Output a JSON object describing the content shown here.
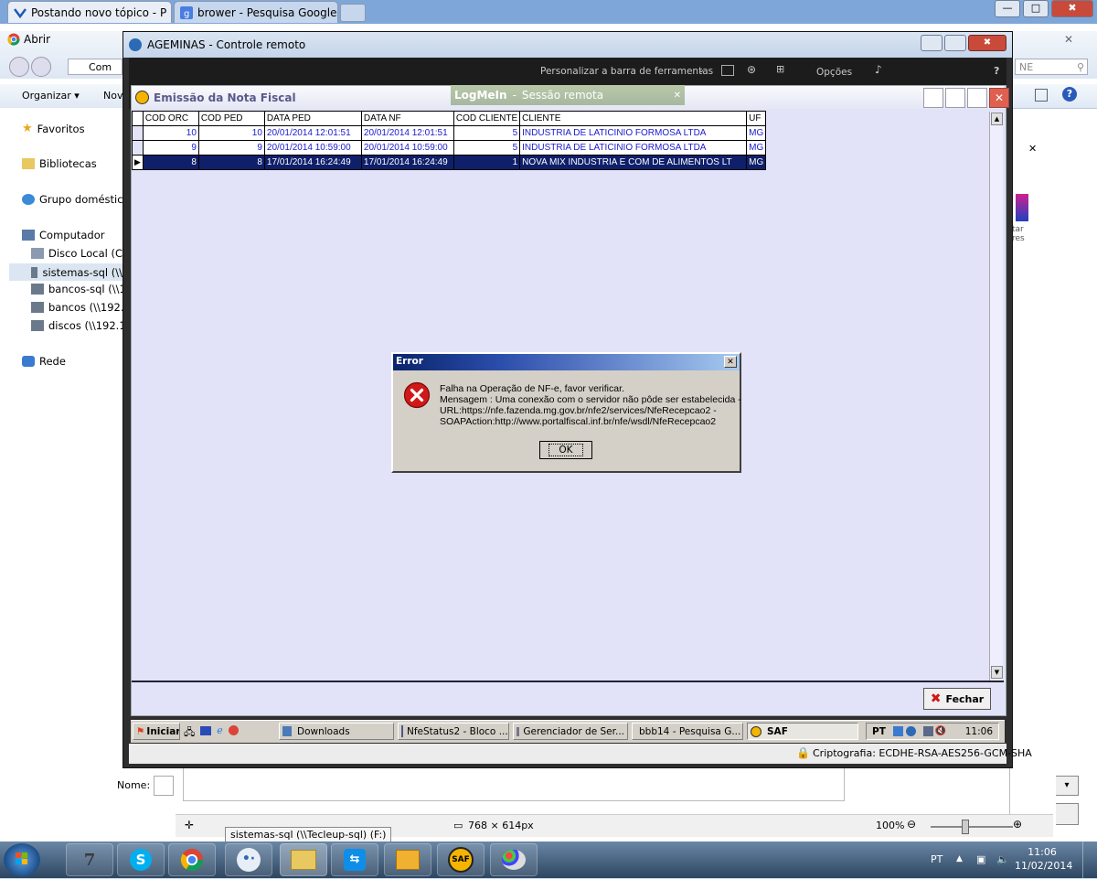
{
  "browser": {
    "tabs": [
      {
        "label": "Postando novo tópico - P"
      },
      {
        "label": "brower - Pesquisa Google"
      }
    ],
    "minimize": "—",
    "maximize": "□",
    "close": "✖"
  },
  "explorer": {
    "open_label": "Abrir",
    "path_label": "Com",
    "organize_label": "Organizar ▾",
    "new_label": "Nov",
    "search_placeholder": "NE",
    "nav": {
      "favorites": "Favoritos",
      "libraries": "Bibliotecas",
      "homegroup": "Grupo doméstico",
      "computer": "Computador",
      "local_disk": "Disco Local (C:)",
      "sistemas": "sistemas-sql (\\\\",
      "bancos_sql": "bancos-sql (\\\\19",
      "bancos": "bancos (\\\\192.16",
      "discos": "discos (\\\\192.16",
      "network": "Rede"
    },
    "name_label": "Nome:",
    "right_text": "tar res",
    "dimension": "768 × 614px",
    "zoom": "100%",
    "tooltip": "sistemas-sql (\\\\Tecleup-sql) (F:)"
  },
  "remote": {
    "title": "AGEMINAS - Controle remoto",
    "toolbar": {
      "customize": "Personalizar a barra de ferramentas",
      "options": "Opções",
      "help": "?"
    },
    "logmein": "LogMeIn",
    "session": "Sessão remota",
    "encryption": "Criptografia: ECDHE-RSA-AES256-GCM-SHA"
  },
  "saf": {
    "title": "Emissão da Nota Fiscal",
    "columns": [
      "COD ORC",
      "COD PED",
      "DATA PED",
      "DATA NF",
      "COD CLIENTE",
      "CLIENTE",
      "UF"
    ],
    "rows": [
      [
        "10",
        "10",
        "20/01/2014 12:01:51",
        "20/01/2014 12:01:51",
        "5",
        "INDUSTRIA DE LATICINIO FORMOSA LTDA",
        "MG"
      ],
      [
        "9",
        "9",
        "20/01/2014 10:59:00",
        "20/01/2014 10:59:00",
        "5",
        "INDUSTRIA DE LATICINIO FORMOSA LTDA",
        "MG"
      ],
      [
        "8",
        "8",
        "17/01/2014 16:24:49",
        "17/01/2014 16:24:49",
        "1",
        "NOVA MIX INDUSTRIA E COM DE ALIMENTOS LT",
        "MG"
      ]
    ],
    "close_button": "Fechar"
  },
  "error": {
    "title": "Error",
    "line1": "Falha na Operação de NF-e, favor verificar.",
    "line2": "Mensagem : Uma conexão com o servidor não pôde ser estabelecida -",
    "line3": "URL:https://nfe.fazenda.mg.gov.br/nfe2/services/NfeRecepcao2 -",
    "line4": "SOAPAction:http://www.portalfiscal.inf.br/nfe/wsdl/NfeRecepcao2",
    "ok": "OK",
    "close": "✕"
  },
  "remote_taskbar": {
    "start": "Iniciar",
    "items": [
      "Downloads",
      "NfeStatus2 - Bloco ...",
      "Gerenciador de Ser...",
      "bbb14 - Pesquisa G...",
      "SAF"
    ],
    "lang": "PT",
    "time": "11:06"
  },
  "taskbar": {
    "lang": "PT",
    "time": "11:06",
    "date": "11/02/2014"
  },
  "colors": {
    "selection": "#0f1f6a",
    "saf_bg": "#e2e2f8",
    "error_icon": "#d01818"
  }
}
